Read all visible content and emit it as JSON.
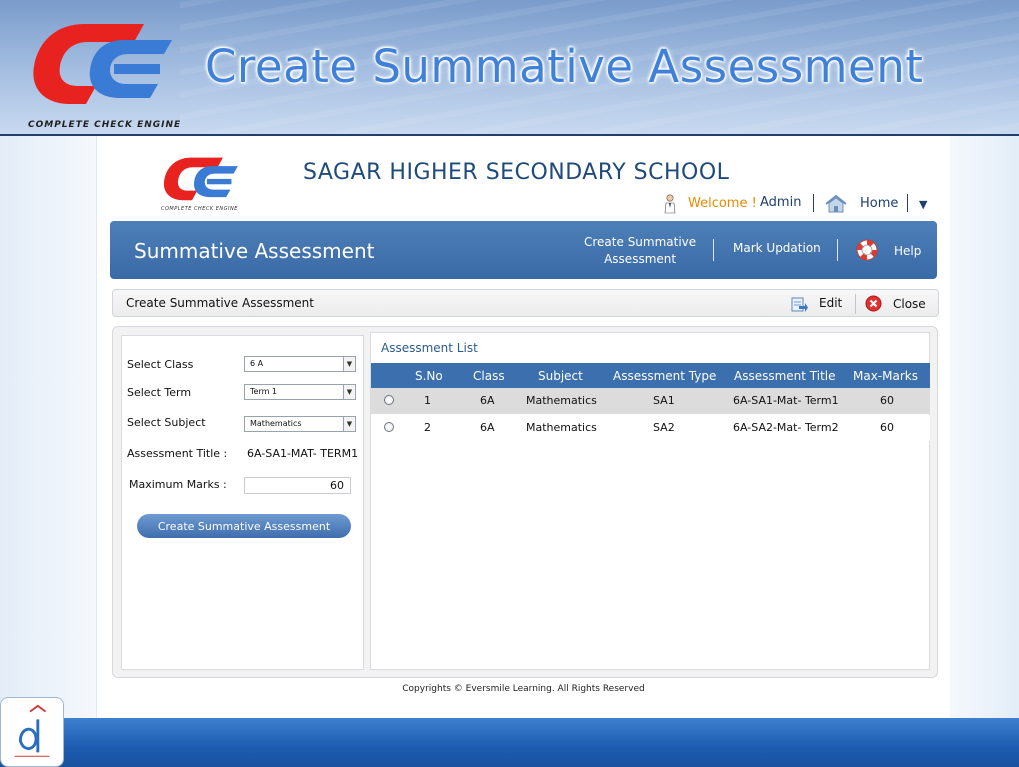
{
  "slide": {
    "title": "Create Summative Assessment",
    "logo_caption": "COMPLETE CHECK ENGINE"
  },
  "school": {
    "name": "SAGAR HIGHER SECONDARY SCHOOL",
    "logo_caption": "COMPLETE CHECK ENGINE"
  },
  "userbar": {
    "welcome": "Welcome !",
    "user": "Admin",
    "home": "Home",
    "separator": "|"
  },
  "navbar": {
    "title": "Summative Assessment",
    "items": [
      {
        "label_line1": "Create Summative",
        "label_line2": "Assessment"
      },
      {
        "label_line1": "Mark Updation",
        "label_line2": ""
      },
      {
        "label_line1": "Help",
        "label_line2": ""
      }
    ]
  },
  "toolbar": {
    "title": "Create Summative Assessment",
    "edit": "Edit",
    "close": "Close"
  },
  "form": {
    "class_label": "Select Class",
    "class_value": "6 A",
    "term_label": "Select Term",
    "term_value": "Term 1",
    "subject_label": "Select Subject",
    "subject_value": "Mathematics",
    "title_label": "Assessment Title :",
    "title_value": "6A-SA1-MAT- TERM1",
    "marks_label": "Maximum Marks :",
    "marks_value": "60",
    "create_button": "Create Summative Assessment"
  },
  "list": {
    "title": "Assessment List",
    "columns": [
      "S.No",
      "Class",
      "Subject",
      "Assessment Type",
      "Assessment Title",
      "Max-Marks"
    ],
    "rows": [
      {
        "sno": "1",
        "class": "6A",
        "subject": "Mathematics",
        "type": "SA1",
        "title": "6A-SA1-Mat- Term1",
        "max": "60"
      },
      {
        "sno": "2",
        "class": "6A",
        "subject": "Mathematics",
        "type": "SA2",
        "title": "6A-SA2-Mat- Term2",
        "max": "60"
      }
    ]
  },
  "footer": {
    "copyright": "Copyrights © Eversmile Learning. All Rights Reserved"
  },
  "colors": {
    "navbar": "#3a6aa6",
    "accent_red": "#e8231f",
    "accent_blue": "#3a7bd5",
    "welcome": "#e68a00",
    "school_name": "#1f4a7c"
  }
}
